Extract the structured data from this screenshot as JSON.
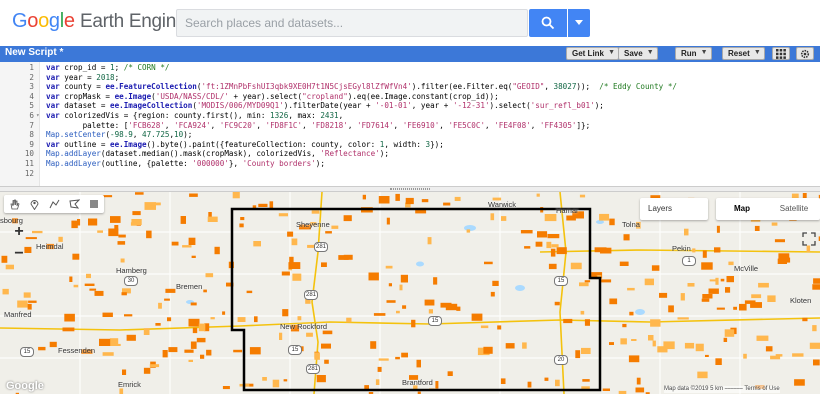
{
  "header": {
    "logo_google": "Google",
    "logo_rest": "Earth Engine",
    "search_placeholder": "Search places and datasets..."
  },
  "script_panel": {
    "title": "New Script *",
    "buttons": {
      "get_link": "Get Link",
      "save": "Save",
      "run": "Run",
      "reset": "Reset"
    }
  },
  "editor": {
    "lines": [
      {
        "n": "1",
        "segs": [
          [
            "kw",
            "var"
          ],
          [
            "t",
            " crop_id = "
          ],
          [
            "num",
            "1"
          ],
          [
            "t",
            "; "
          ],
          [
            "cm",
            "/* CORN */"
          ]
        ]
      },
      {
        "n": "2",
        "segs": [
          [
            "kw",
            "var"
          ],
          [
            "t",
            " year = "
          ],
          [
            "num",
            "2018"
          ],
          [
            "t",
            ";"
          ]
        ]
      },
      {
        "n": "3",
        "segs": [
          [
            "kw",
            "var"
          ],
          [
            "t",
            " county = "
          ],
          [
            "kw",
            "ee.FeatureCollection"
          ],
          [
            "t",
            "("
          ],
          [
            "str",
            "'ft:1ZMnPbFshUI3qbk9XE0H7t1N5CjsEGyl8lZfWfVn4'"
          ],
          [
            "t",
            ").filter(ee.Filter.eq("
          ],
          [
            "str",
            "\"GEOID\""
          ],
          [
            "t",
            ", "
          ],
          [
            "num",
            "38027"
          ],
          [
            "t",
            "));  "
          ],
          [
            "cm",
            "/* Eddy County */"
          ]
        ]
      },
      {
        "n": "4",
        "segs": [
          [
            "kw",
            "var"
          ],
          [
            "t",
            " cropMask = "
          ],
          [
            "kw",
            "ee.Image"
          ],
          [
            "t",
            "("
          ],
          [
            "str",
            "'USDA/NASS/CDL/'"
          ],
          [
            "t",
            " + year).select("
          ],
          [
            "str",
            "\"cropland\""
          ],
          [
            "t",
            ").eq(ee.Image.constant(crop_id));"
          ]
        ]
      },
      {
        "n": "5",
        "segs": [
          [
            "kw",
            "var"
          ],
          [
            "t",
            " dataset = "
          ],
          [
            "kw",
            "ee.ImageCollection"
          ],
          [
            "t",
            "("
          ],
          [
            "str",
            "'MODIS/006/MYD09Q1'"
          ],
          [
            "t",
            ").filterDate(year + "
          ],
          [
            "str",
            "'-01-01'"
          ],
          [
            "t",
            ", year + "
          ],
          [
            "str",
            "'-12-31'"
          ],
          [
            "t",
            ").select("
          ],
          [
            "str",
            "'sur_refl_b01'"
          ],
          [
            "t",
            ");"
          ]
        ]
      },
      {
        "n": "6",
        "fold": "▾",
        "segs": [
          [
            "kw",
            "var"
          ],
          [
            "t",
            " colorizedVis = {region: county.first(), min: "
          ],
          [
            "num",
            "1326"
          ],
          [
            "t",
            ", max: "
          ],
          [
            "num",
            "2431"
          ],
          [
            "t",
            ","
          ]
        ]
      },
      {
        "n": "7",
        "segs": [
          [
            "t",
            "        palette: ["
          ],
          [
            "str",
            "'FCB628'"
          ],
          [
            "t",
            ", "
          ],
          [
            "str",
            "'FCA924'"
          ],
          [
            "t",
            ", "
          ],
          [
            "str",
            "'FC9C20'"
          ],
          [
            "t",
            ", "
          ],
          [
            "str",
            "'FD8F1C'"
          ],
          [
            "t",
            ", "
          ],
          [
            "str",
            "'FD8218'"
          ],
          [
            "t",
            ", "
          ],
          [
            "str",
            "'FD7614'"
          ],
          [
            "t",
            ", "
          ],
          [
            "str",
            "'FE6910'"
          ],
          [
            "t",
            ", "
          ],
          [
            "str",
            "'FE5C0C'"
          ],
          [
            "t",
            ", "
          ],
          [
            "str",
            "'FE4F08'"
          ],
          [
            "t",
            ", "
          ],
          [
            "str",
            "'FF4305'"
          ],
          [
            "t",
            "]};"
          ]
        ]
      },
      {
        "n": "8",
        "segs": [
          [
            "fn",
            "Map.setCenter"
          ],
          [
            "t",
            "("
          ],
          [
            "num",
            "-98.9"
          ],
          [
            "t",
            ", "
          ],
          [
            "num",
            "47.725"
          ],
          [
            "t",
            ","
          ],
          [
            "num",
            "10"
          ],
          [
            "t",
            ");"
          ]
        ]
      },
      {
        "n": "9",
        "segs": [
          [
            "kw",
            "var"
          ],
          [
            "t",
            " outline = "
          ],
          [
            "kw",
            "ee.Image"
          ],
          [
            "t",
            "().byte().paint({featureCollection: county, color: "
          ],
          [
            "num",
            "1"
          ],
          [
            "t",
            ", width: "
          ],
          [
            "num",
            "3"
          ],
          [
            "t",
            "});"
          ]
        ]
      },
      {
        "n": "10",
        "segs": [
          [
            "fn",
            "Map.addLayer"
          ],
          [
            "t",
            "(dataset.median().mask(cropMask), colorizedVis, "
          ],
          [
            "str",
            "'Reflectance'"
          ],
          [
            "t",
            ");"
          ]
        ]
      },
      {
        "n": "11",
        "segs": [
          [
            "fn",
            "Map.addLayer"
          ],
          [
            "t",
            "(outline, {palette: "
          ],
          [
            "str",
            "'000000'"
          ],
          [
            "t",
            "}, "
          ],
          [
            "str",
            "'County borders'"
          ],
          [
            "t",
            ");"
          ]
        ]
      },
      {
        "n": "12",
        "segs": []
      }
    ]
  },
  "map": {
    "layers_label": "Layers",
    "map_label": "Map",
    "satellite_label": "Satellite",
    "zoom_in": "+",
    "zoom_out": "−",
    "google": "Google",
    "attribution": "Map data ©2019   5 km ⎯⎯⎯⎯⎯⎯   Terms of Use",
    "towns": {
      "sheyenne": "Sheyenne",
      "warwick": "Warwick",
      "hamar": "Hamar",
      "tolna": "Tolna",
      "pekin": "Pekin",
      "mcville": "McVille",
      "kloten": "Kloten",
      "heimdal": "Heimdal",
      "hamberg": "Hamberg",
      "bremen": "Bremen",
      "manfred": "Manfred",
      "fessenden": "Fessenden",
      "new_rockford": "New Rockford",
      "brantford": "Brantford",
      "emrick": "Emrick",
      "esbourg": "sbourg"
    },
    "shields": {
      "s281": "281",
      "s30": "30",
      "s15a": "15",
      "s15b": "15",
      "s15c": "15",
      "s15d": "15",
      "s1": "1",
      "s281b": "281",
      "s281c": "281",
      "s20": "20"
    },
    "colors": {
      "crop_fill": "#f57c00",
      "crop_light": "#ffb74d",
      "outline": "#000000"
    }
  }
}
